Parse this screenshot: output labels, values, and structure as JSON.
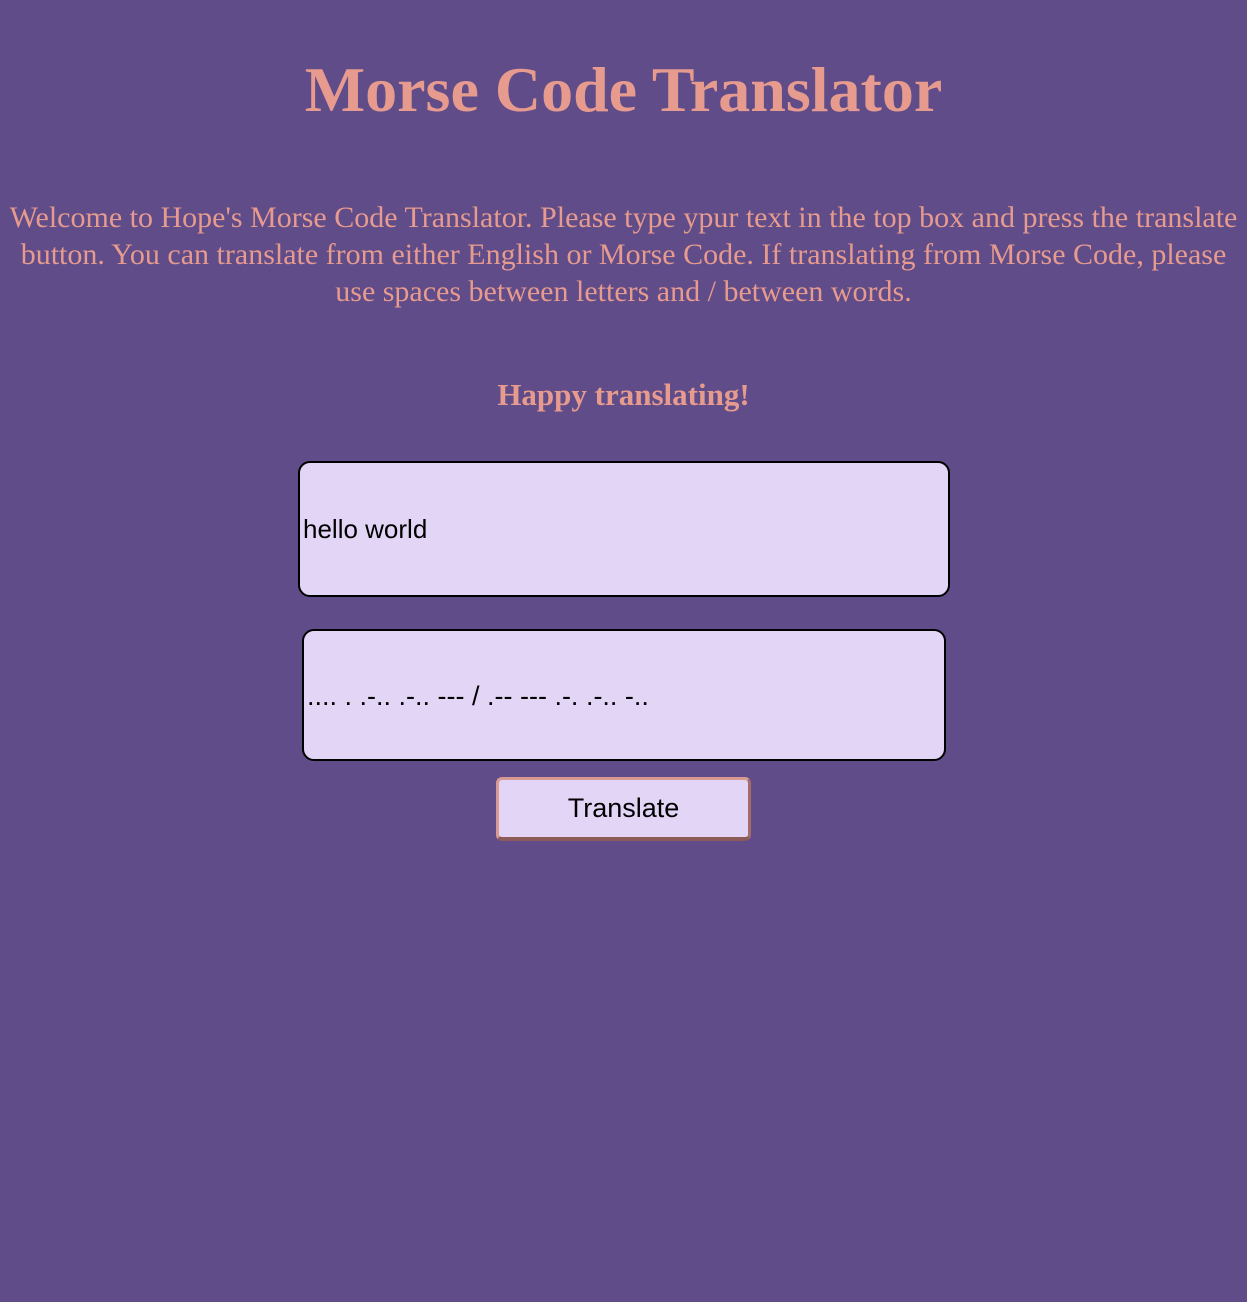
{
  "page": {
    "title": "Morse Code Translator",
    "intro": "Welcome to Hope's Morse Code Translator. Please type ypur text in the top box and press the translate button. You can translate from either English or Morse Code. If translating from Morse Code, please use spaces between letters and / between words.",
    "happy": "Happy translating!"
  },
  "translator": {
    "input_value": "hello world",
    "output_value": ".... . .-.. .-.. --- / .-- --- .-. .-.. -..",
    "button_label": "Translate"
  },
  "colors": {
    "background": "#5f4c89",
    "heading_text": "#e79a8e",
    "box_background": "#e3d5f5",
    "box_border": "#000000",
    "button_border": "#d99a93"
  }
}
